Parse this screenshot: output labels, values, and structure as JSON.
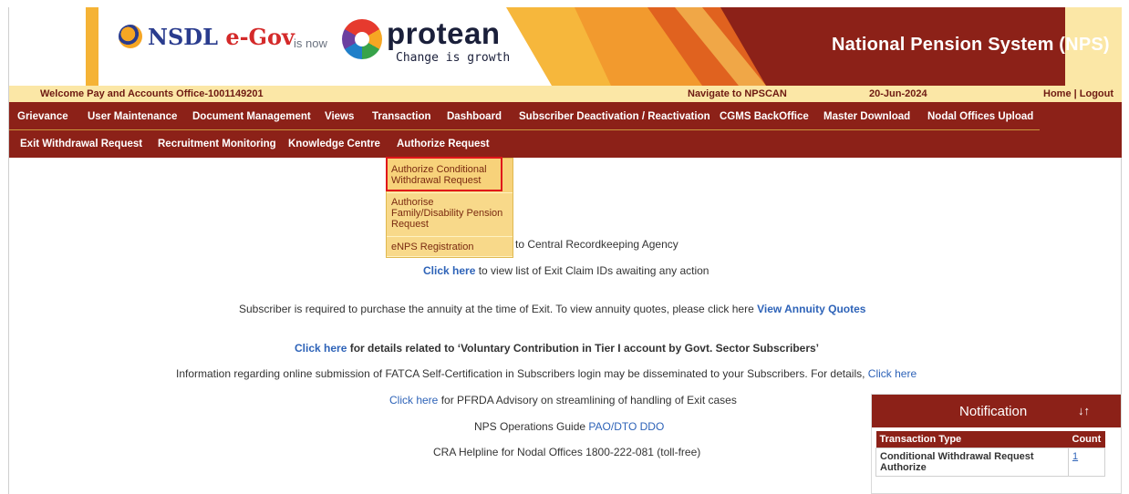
{
  "header": {
    "nsdl_logo_text_1": "NSDL ",
    "nsdl_logo_text_2": "e-Gov",
    "is_now": "is now",
    "protean_name": "protean",
    "protean_tagline": "Change is growth",
    "system_title": "National Pension System (NPS)"
  },
  "infobar": {
    "welcome": "Welcome Pay and Accounts Office-1001149201",
    "navigate": "Navigate to NPSCAN",
    "date": "20-Jun-2024",
    "home": "Home",
    "separator": " | ",
    "logout": "Logout"
  },
  "menu_row_1": [
    "Grievance",
    "User Maintenance",
    "Document Management",
    "Views",
    "Transaction",
    "Dashboard",
    "Subscriber Deactivation / Reactivation",
    "CGMS BackOffice",
    "Master Download",
    "Nodal Offices Upload"
  ],
  "menu_row_2": [
    "Exit Withdrawal Request",
    "Recruitment Monitoring",
    "Knowledge Centre",
    "Authorize Request"
  ],
  "dropdown": {
    "item_1_line_1": "Authorize Conditional",
    "item_1_line_2": "Withdrawal Request",
    "item_2_line_1": "Authorise",
    "item_2_line_2": "Family/Disability Pension",
    "item_2_line_3": "Request",
    "item_3": "eNPS Registration"
  },
  "content": {
    "cra_text": "to Central Recordkeeping Agency",
    "exit_claim_link": "Click here",
    "exit_claim_text": " to view list of Exit Claim IDs awaiting any action",
    "annuity_text": "Subscriber is required to purchase the annuity at the time of Exit. To view annuity quotes, please click here ",
    "annuity_link": "View Annuity Quotes",
    "voluntary_link": "Click here",
    "voluntary_text": " for details related to ‘Voluntary Contribution in Tier I account by Govt. Sector Subscribers’",
    "fatca_text": "Information regarding online submission of FATCA Self-Certification in Subscribers login may be disseminated to your Subscribers. For details, ",
    "fatca_link": "Click here",
    "pfrda_link": "Click here",
    "pfrda_text": " for PFRDA Advisory on streamlining of handling of Exit cases",
    "ops_guide_text": "NPS Operations Guide ",
    "ops_guide_link": "PAO/DTO DDO",
    "helpline_text": "CRA Helpline for Nodal Offices 1800-222-081 (toll-free)"
  },
  "notification": {
    "title": "Notification",
    "sort_glyph": "↓↑",
    "col_type": "Transaction Type",
    "col_count": "Count",
    "rows": [
      {
        "type": "Conditional Withdrawal Request Authorize",
        "count": "1"
      }
    ]
  },
  "colors": {
    "menu_bg": "#8c2118",
    "infobar_bg": "#fbe7a6",
    "dropdown_bg": "#f7d77e",
    "link": "#2e63b8",
    "highlight_box": "#e0161a"
  }
}
